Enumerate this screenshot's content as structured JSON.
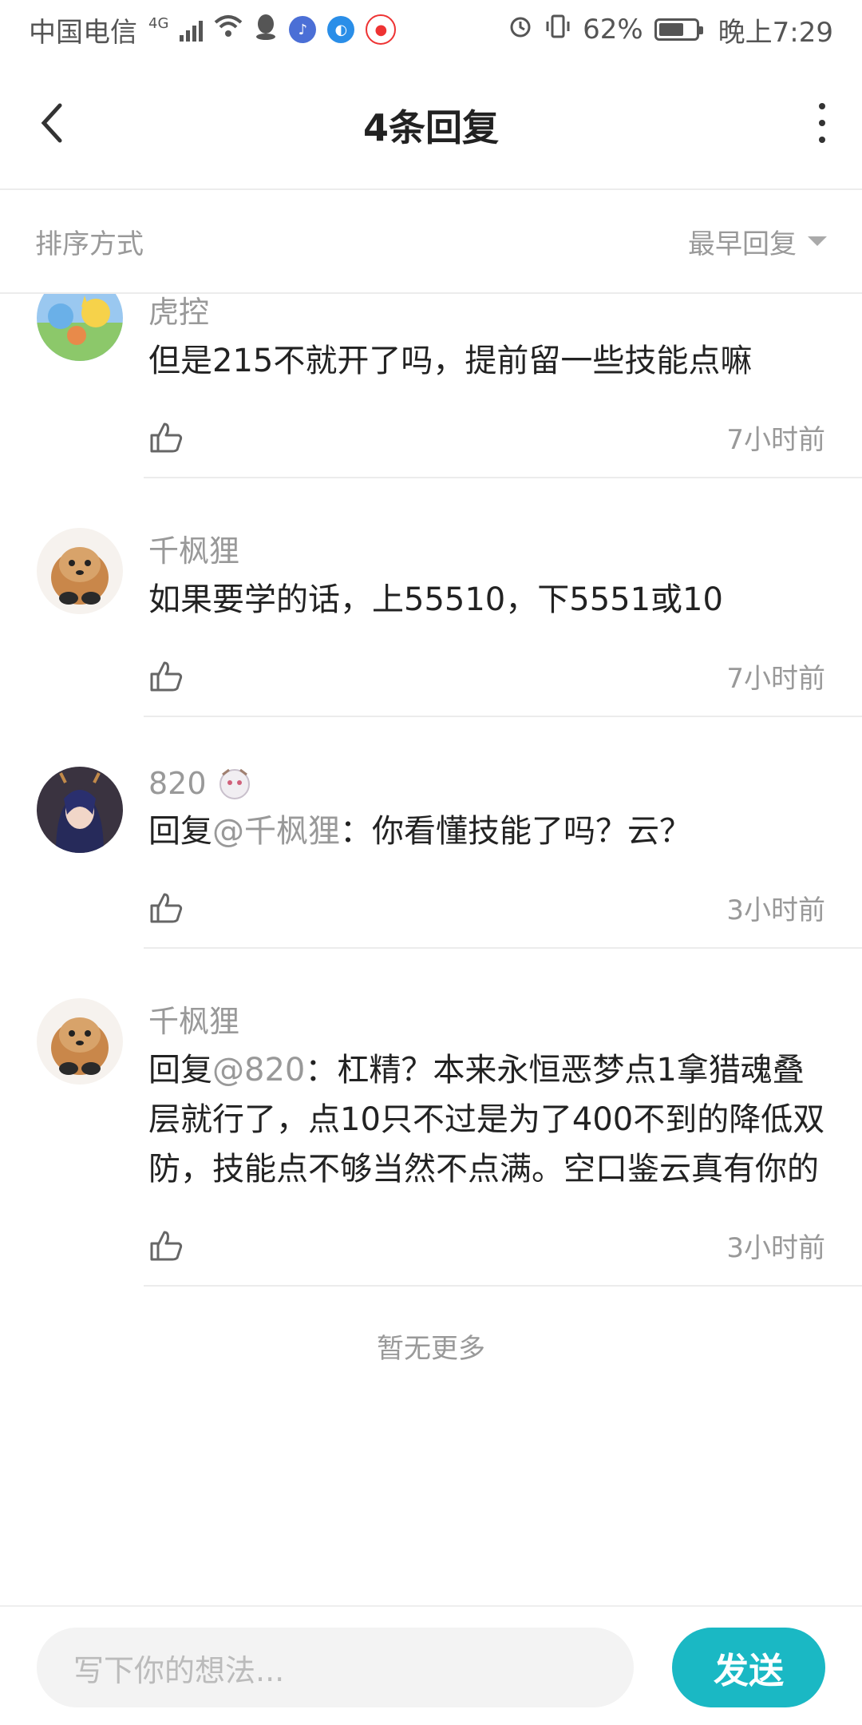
{
  "status_bar": {
    "carrier": "中国电信",
    "net": "4G",
    "battery": "62%",
    "time": "晚上7:29",
    "icons": [
      "signal-icon",
      "wifi-icon",
      "qq-icon",
      "music-icon",
      "browser-icon",
      "map-icon",
      "alarm-icon",
      "vibrate-icon",
      "battery-icon"
    ]
  },
  "header": {
    "title": "4条回复"
  },
  "sort": {
    "label": "排序方式",
    "value": "最早回复"
  },
  "comments": [
    {
      "name": "虎控",
      "text": "但是215不就开了吗，提前留一些技能点嘛",
      "time": "7小时前"
    },
    {
      "name": "千枫狸",
      "text": "如果要学的话，上55510，下5551或10",
      "time": "7小时前"
    },
    {
      "name": "820",
      "reply_prefix": "回复",
      "mention": "@千枫狸",
      "text": "：你看懂技能了吗？云？",
      "time": "3小时前"
    },
    {
      "name": "千枫狸",
      "reply_prefix": "回复",
      "mention": "@820",
      "text": "：杠精？本来永恒恶梦点1拿猎魂叠层就行了，点10只不过是为了400不到的降低双防，技能点不够当然不点满。空口鉴云真有你的",
      "time": "3小时前"
    }
  ],
  "no_more": "暂无更多",
  "footer": {
    "placeholder": "写下你的想法...",
    "send": "发送"
  },
  "colors": {
    "accent": "#1ab8c4"
  }
}
